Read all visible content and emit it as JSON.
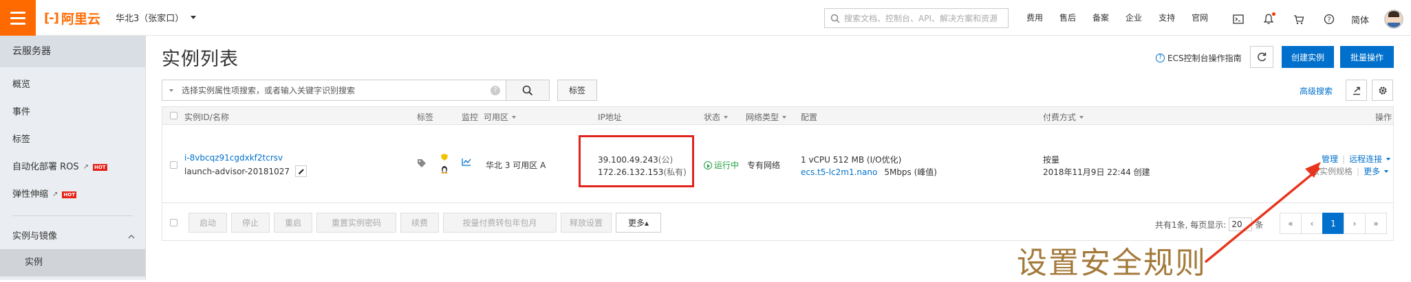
{
  "header": {
    "logo_text": "阿里云",
    "region": "华北3（张家口）",
    "search_placeholder": "搜索文档、控制台、API、解决方案和资源",
    "nav": [
      "费用",
      "售后",
      "备案",
      "企业",
      "支持",
      "官网"
    ],
    "lang": "简体"
  },
  "sidebar": {
    "title": "云服务器",
    "items": [
      {
        "label": "概览"
      },
      {
        "label": "事件"
      },
      {
        "label": "标签"
      },
      {
        "label": "自动化部署 ROS",
        "hot": "HOT"
      },
      {
        "label": "弹性伸缩",
        "hot": "HOT"
      }
    ],
    "group": "实例与镜像",
    "active_item": "实例"
  },
  "main": {
    "title": "实例列表",
    "guide": "ECS控制台操作指南",
    "create_button": "创建实例",
    "batch_button": "批量操作",
    "filter_placeholder": "选择实例属性项搜索，或者输入关键字识别搜索",
    "tag_button": "标签",
    "advanced_search": "高级搜索"
  },
  "table": {
    "headers": {
      "id_name": "实例ID/名称",
      "tag": "标签",
      "monitor": "监控",
      "zone": "可用区",
      "ip": "IP地址",
      "status": "状态",
      "network": "网络类型",
      "config": "配置",
      "billing": "付费方式",
      "actions": "操作"
    },
    "row": {
      "instance_id": "i-8vbcqz91cgdxkf2tcrsv",
      "name": "launch-advisor-20181027",
      "zone": "华北 3 可用区 A",
      "public_ip": "39.100.49.243",
      "public_suffix": "(公)",
      "private_ip": "172.26.132.153",
      "private_suffix": "(私有)",
      "status": "运行中",
      "network": "专有网络",
      "config_line1": "1 vCPU 512 MB (I/O优化)",
      "instance_type": "ecs.t5-lc2m1.nano",
      "bandwidth": "5Mbps (峰值)",
      "billing": "按量",
      "created": "2018年11月9日 22:44 创建",
      "action_manage": "管理",
      "action_remote": "远程连接",
      "action_change": "改实例规格",
      "action_more": "更多"
    },
    "footer_buttons": [
      "启动",
      "停止",
      "重启",
      "重置实例密码",
      "续费",
      "按量付费转包年包月",
      "释放设置"
    ],
    "more_button": "更多▴",
    "pager": {
      "summary": "共有1条, 每页显示:",
      "page_size": "20",
      "unit": "条",
      "first": "«",
      "prev": "‹",
      "current": "1",
      "next": "›",
      "last": "»"
    }
  },
  "annotation": {
    "text": "设置安全规则",
    "color": "#a47a3b",
    "arrow_color": "#e8341c"
  },
  "colors": {
    "brand": "#ff6a00",
    "primary": "#0070cc",
    "highlight": "#e0241c",
    "running": "#1e9e3b"
  }
}
